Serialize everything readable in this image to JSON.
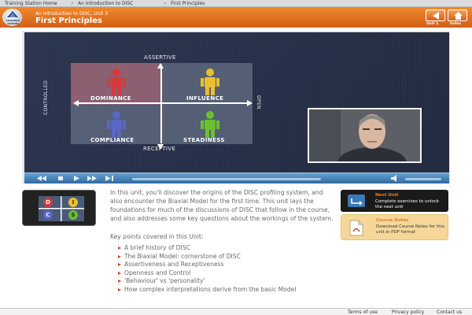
{
  "breadcrumb": {
    "items": [
      "Training Station Home",
      "An Introduction to DISC",
      "First Principles"
    ],
    "separator": "»"
  },
  "header": {
    "logo_text": "LEARNING STATION",
    "subtitle": "An Introduction to DISC, Unit 3",
    "title": "First Principles",
    "unit_label": "Unit 1",
    "index_label": "Index",
    "accent_color": "#e0701f"
  },
  "video": {
    "labels": {
      "top": "ASSERTIVE",
      "bottom": "RECEPTIVE",
      "left": "CONTROLLED",
      "right": "OPEN"
    },
    "quadrants": [
      {
        "label": "DOMINANCE",
        "color": "#d63a3a"
      },
      {
        "label": "INFLUENCE",
        "color": "#e8c030"
      },
      {
        "label": "COMPLIANCE",
        "color": "#5a66c8"
      },
      {
        "label": "STEADINESS",
        "color": "#6cc030"
      }
    ]
  },
  "thumbnail": {
    "letters": [
      "D",
      "I",
      "C",
      "S"
    ]
  },
  "content": {
    "intro": "In this unit, you'll discover the origins of the DISC profiling system, and also encounter the first time. This unit lays the foundations for much of the discussions of DISC that follow in the course, and also addresses some key questions about the workings of the system.",
    "intro_full": "In this unit, you'll discover the origins of the DISC profiling system, and also encounter the Biaxial Model for the first time. This unit lays the foundations for much of the discussions of DISC that follow in the course, and also addresses some key questions about the workings of the system.",
    "key_points_heading": "Key points covered in this Unit:",
    "key_points": [
      "A brief history of DISC",
      "The Biaxial Model: cornerstone of DISC",
      "Assertiveness and Receptiveness",
      "Openness and Control",
      "'Behaviour' vs 'personality'",
      "How complex interpretations derive from the basic Model"
    ]
  },
  "next_unit": {
    "title": "Next Unit",
    "description": "Complete exercises to unlock the next unit"
  },
  "course_notes": {
    "title": "Course Notes",
    "description": "Download Course Notes for this unit in PDF format"
  },
  "footer": {
    "links": [
      "Terms of use",
      "Privacy policy",
      "Contact us"
    ]
  }
}
